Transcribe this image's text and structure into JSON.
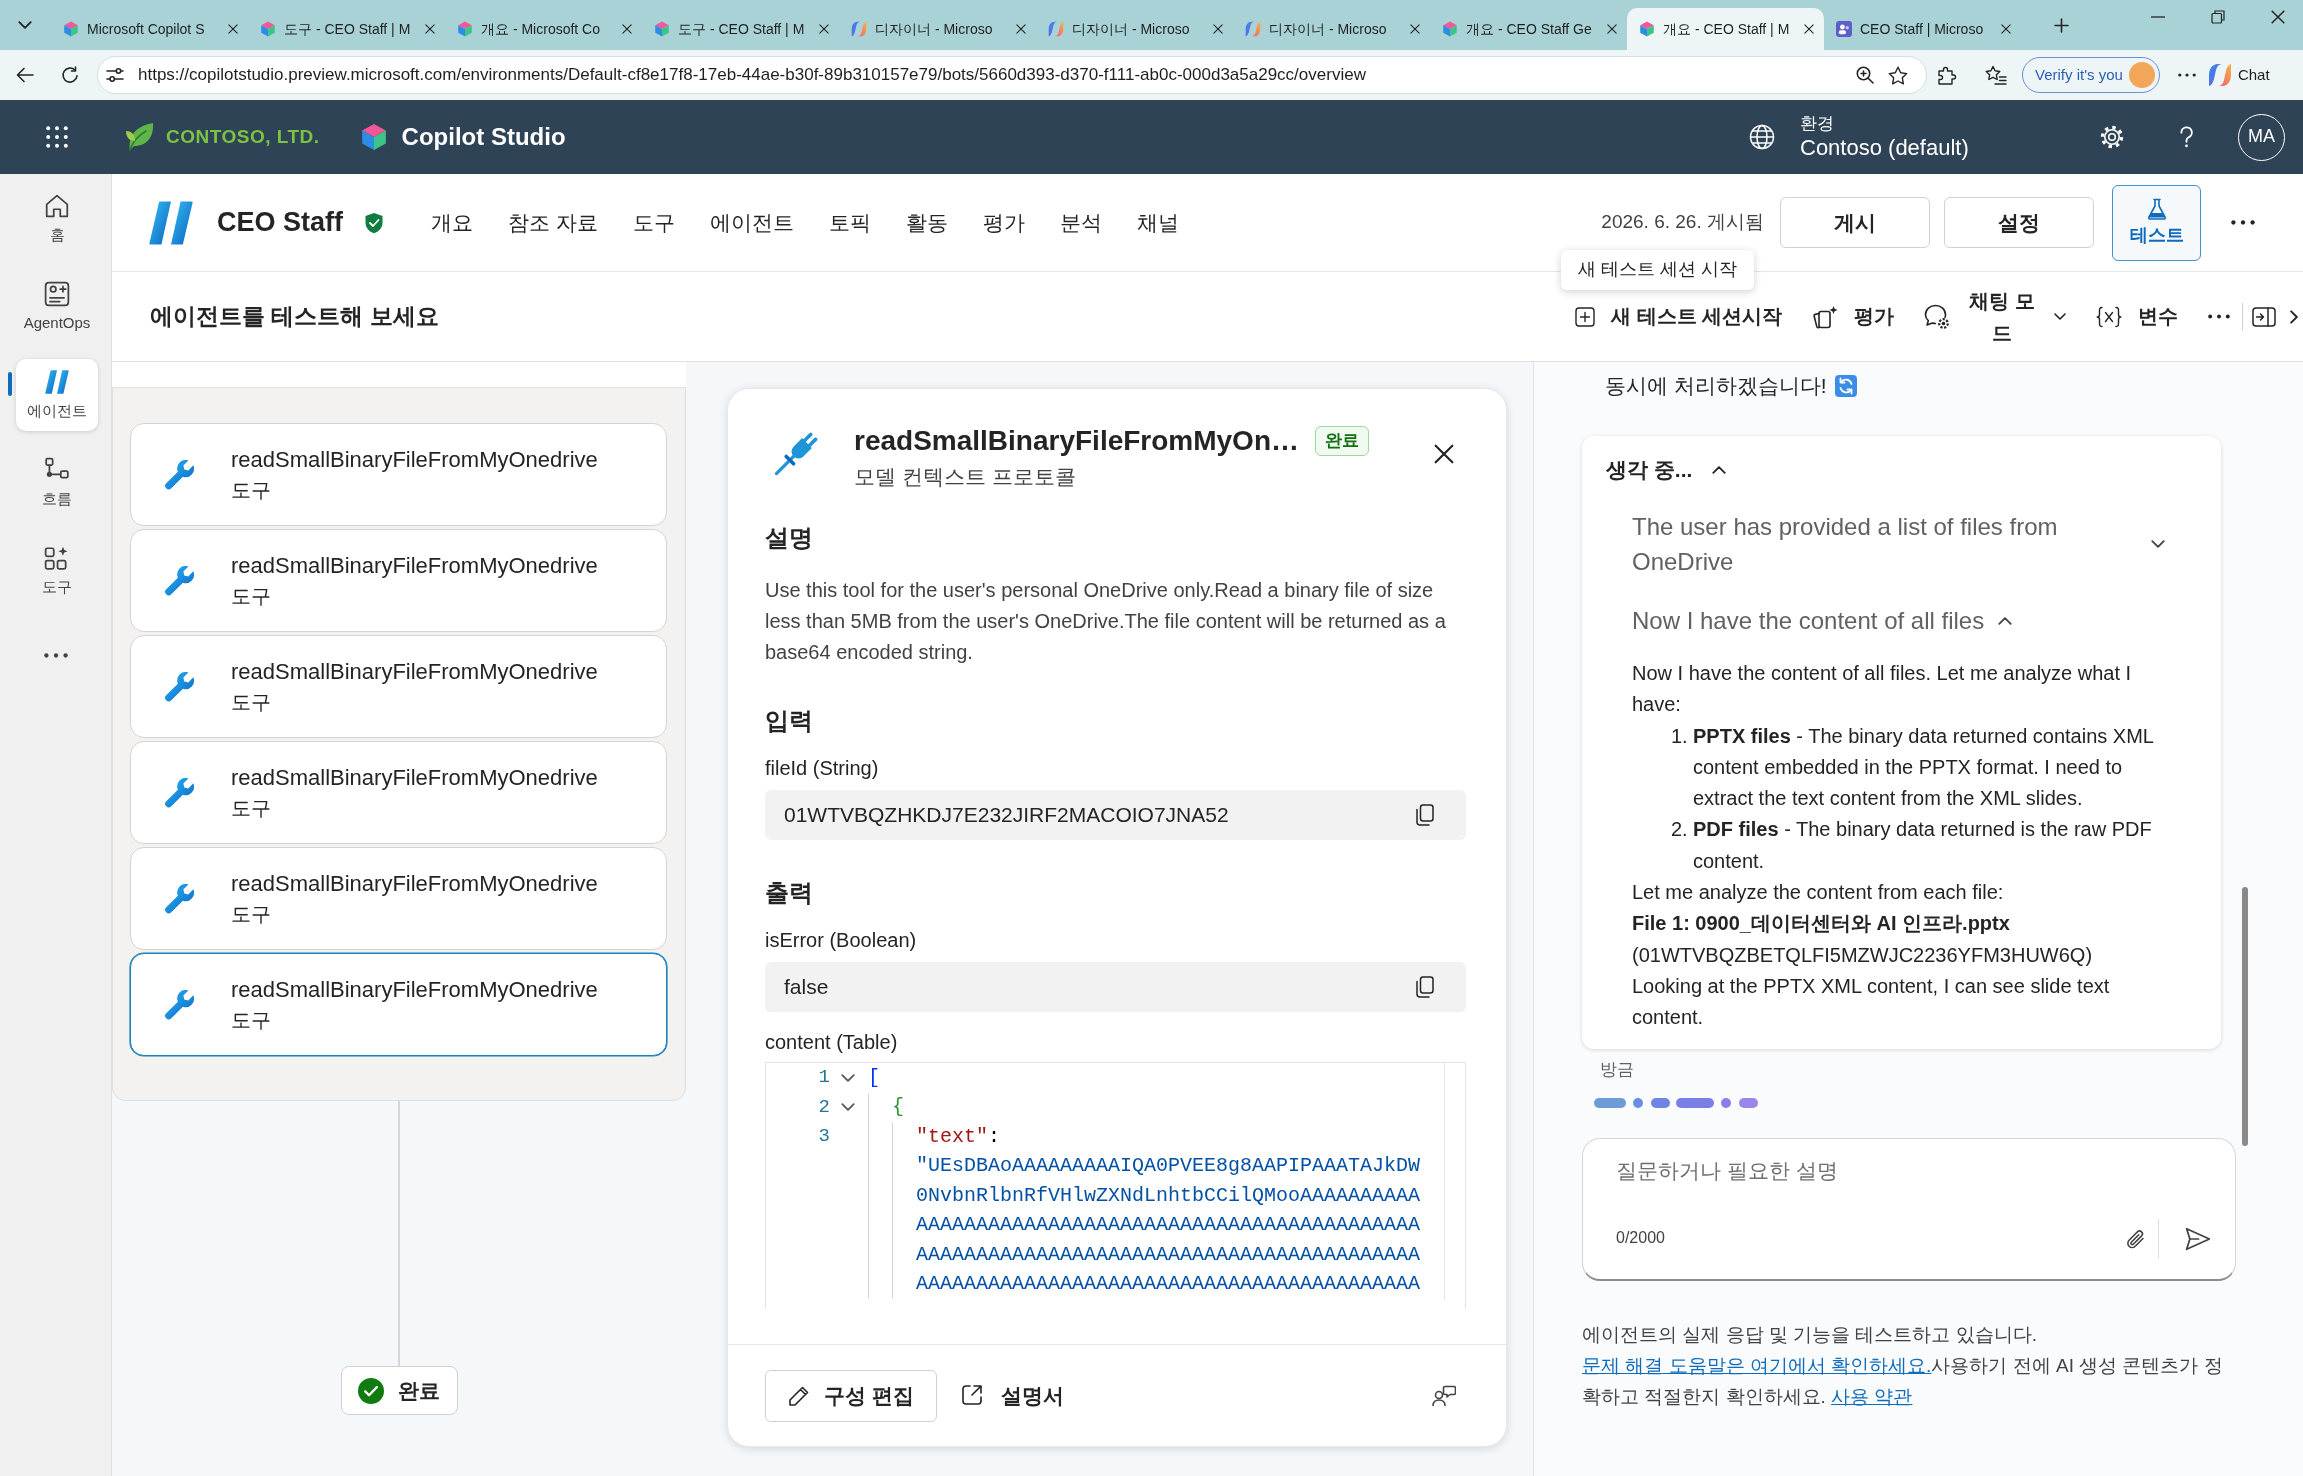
{
  "browser": {
    "tabs": [
      {
        "title": "Microsoft Copilot S",
        "kind": "studio",
        "selected": false
      },
      {
        "title": "도구 - CEO Staff | M",
        "kind": "studio",
        "selected": false
      },
      {
        "title": "개요 - Microsoft Co",
        "kind": "studio",
        "selected": false
      },
      {
        "title": "도구 - CEO Staff | M",
        "kind": "studio",
        "selected": false
      },
      {
        "title": "디자이너 - Microso",
        "kind": "designer",
        "selected": false
      },
      {
        "title": "디자이너 - Microso",
        "kind": "designer",
        "selected": false
      },
      {
        "title": "디자이너 - Microso",
        "kind": "designer",
        "selected": false
      },
      {
        "title": "개요 - CEO Staff Ge",
        "kind": "studio",
        "selected": false
      },
      {
        "title": "개요 - CEO Staff | M",
        "kind": "studio",
        "selected": true
      },
      {
        "title": "CEO Staff | Microso",
        "kind": "people",
        "selected": false
      }
    ],
    "url": "https://copilotstudio.preview.microsoft.com/environments/Default-cf8e17f8-17eb-44ae-b30f-89b310157e79/bots/5660d393-d370-f111-ab0c-000d3a5a29cc/overview",
    "verify_label": "Verify it's you",
    "chat_label": "Chat"
  },
  "app_bar": {
    "company": "CONTOSO, LTD.",
    "product": "Copilot Studio",
    "environment_caption": "환경",
    "environment": "Contoso (default)",
    "user_initials": "MA"
  },
  "rail": [
    {
      "kind": "home",
      "label": "홈",
      "selected": false
    },
    {
      "kind": "agentops",
      "label": "AgentOps",
      "selected": false
    },
    {
      "kind": "agents",
      "label": "에이전트",
      "selected": true
    },
    {
      "kind": "flows",
      "label": "흐름",
      "selected": false
    },
    {
      "kind": "tools",
      "label": "도구",
      "selected": false
    }
  ],
  "agent_bar": {
    "name": "CEO Staff",
    "nav": [
      {
        "label": "개요",
        "selected": false
      },
      {
        "label": "참조 자료",
        "selected": false
      },
      {
        "label": "도구",
        "selected": false
      },
      {
        "label": "에이전트",
        "selected": false
      },
      {
        "label": "토픽",
        "selected": false
      },
      {
        "label": "활동",
        "selected": false
      },
      {
        "label": "평가",
        "selected": false
      },
      {
        "label": "분석",
        "selected": false
      },
      {
        "label": "채널",
        "selected": false
      }
    ],
    "status": "2026. 6. 26. 게시됨",
    "buttons": [
      {
        "kind": "publish",
        "label": "게시",
        "selected": false
      },
      {
        "kind": "settings",
        "label": "설정",
        "selected": false
      },
      {
        "kind": "test",
        "label": "테스트",
        "selected": true
      }
    ]
  },
  "test_bar": {
    "title": "에이전트를 테스트해 보세요",
    "tools": [
      {
        "kind": "new_session",
        "label": "새 테스트 세션시작"
      },
      {
        "kind": "evaluate",
        "label": "평가"
      },
      {
        "kind": "chat_mode",
        "label": "채팅 모드"
      },
      {
        "kind": "variables",
        "label": "변수"
      }
    ],
    "tooltip": "새 테스트 세션 시작"
  },
  "activity": {
    "tools": [
      {
        "name": "readSmallBinaryFileFromMyOnedrive",
        "type": "도구",
        "selected": false
      },
      {
        "name": "readSmallBinaryFileFromMyOnedrive",
        "type": "도구",
        "selected": false
      },
      {
        "name": "readSmallBinaryFileFromMyOnedrive",
        "type": "도구",
        "selected": false
      },
      {
        "name": "readSmallBinaryFileFromMyOnedrive",
        "type": "도구",
        "selected": false
      },
      {
        "name": "readSmallBinaryFileFromMyOnedrive",
        "type": "도구",
        "selected": false
      },
      {
        "name": "readSmallBinaryFileFromMyOnedrive",
        "type": "도구",
        "selected": true
      }
    ],
    "end_node": "완료"
  },
  "tool_detail": {
    "title": "readSmallBinaryFileFromMyOn…",
    "status": "완료",
    "subtitle": "모델 컨텍스트 프로토콜",
    "sections": [
      {
        "kind": "text",
        "heading": "설명",
        "text": "Use this tool for the user's personal OneDrive only.Read a binary file of size less than 5MB from the user's OneDrive.The file content will be returned as a base64 encoded string."
      },
      {
        "kind": "fields",
        "heading": "입력",
        "fields": [
          {
            "kind": "value",
            "label": "fileId (String)",
            "value": "01WTVBQZHKDJ7E232JIRF2MACOIO7JNA52"
          }
        ]
      },
      {
        "kind": "fields",
        "heading": "출력",
        "fields": [
          {
            "kind": "value",
            "label": "isError (Boolean)",
            "value": "false"
          },
          {
            "kind": "code",
            "label": "content (Table)",
            "lines": [
              {
                "number": "1",
                "expanded": true,
                "bracket": "[",
                "children": [
                  {
                    "number": "2",
                    "expanded": true,
                    "bracket": "{",
                    "children": [
                      {
                        "number": "3",
                        "key": "\"text\"",
                        "separator": ":",
                        "value_rows": [
                          "\"UEsDBAoAAAAAAAAAIQA0PVEE8g8AAPIPAAATAJkDW",
                          "0NvbnRlbnRfVHlwZXNdLnhtbCCilQMooAAAAAAAAAA",
                          "AAAAAAAAAAAAAAAAAAAAAAAAAAAAAAAAAAAAAAAAAA",
                          "AAAAAAAAAAAAAAAAAAAAAAAAAAAAAAAAAAAAAAAAAA",
                          "AAAAAAAAAAAAAAAAAAAAAAAAAAAAAAAAAAAAAAAAAA"
                        ]
                      }
                    ]
                  }
                ]
              }
            ]
          }
        ]
      }
    ],
    "actions": [
      {
        "kind": "edit",
        "label": "구성 편집"
      },
      {
        "kind": "docs",
        "label": "설명서"
      }
    ]
  },
  "chat": {
    "message": "동시에 처리하겠습니다!",
    "thinking": {
      "title": "생각 중...",
      "expanded": true,
      "steps": [
        {
          "title": "The user has provided a list of files from OneDrive",
          "expanded": false
        },
        {
          "title": "Now I have the content of all files",
          "expanded": true,
          "blocks": [
            {
              "kind": "paragraph",
              "text": "Now I have the content of all files. Let me analyze what I have:"
            },
            {
              "kind": "list",
              "items": [
                {
                  "number": "1.",
                  "text": "**PPTX files** - The binary data returned contains XML content embedded in the PPTX format. I need to extract the text content from the XML slides."
                },
                {
                  "number": "2.",
                  "text": "**PDF files** - The binary data returned is the raw PDF content."
                }
              ]
            },
            {
              "kind": "paragraph",
              "text": "Let me analyze the content from each file:"
            },
            {
              "kind": "strong",
              "text": "File 1: 0900_데이터센터와 AI 인프라.pptx"
            },
            {
              "kind": "paragraph",
              "text": "(01WTVBQZBETQLFI5MZWJC2236YFM3HUW6Q)"
            },
            {
              "kind": "paragraph",
              "text": "Looking at the PPTX XML content, I can see slide text content."
            }
          ]
        }
      ]
    },
    "timestamp": "방금",
    "composer": {
      "placeholder": "질문하거나 필요한 설명",
      "counter": "0/2000"
    },
    "disclaimer": [
      {
        "kind": "text",
        "text": "에이전트의 실제 응답 및 기능을 테스트하고 있습니다. "
      },
      {
        "kind": "link",
        "text": "문제 해결 도움말은 여기에서 확인하세요."
      },
      {
        "kind": "text",
        "text": "사용하기 전에 AI 생성 콘텐츠가 정확하고 적절한지 확인하세요. "
      },
      {
        "kind": "link",
        "text": "사용 약관"
      }
    ]
  }
}
